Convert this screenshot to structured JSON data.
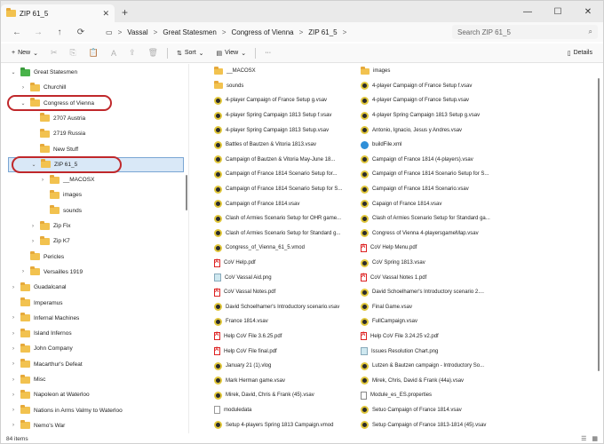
{
  "window": {
    "tab_title": "ZIP 61_5",
    "tab_close": "✕",
    "new_tab": "+",
    "minimize": "—",
    "maximize": "☐",
    "close": "✕"
  },
  "address": {
    "back": "←",
    "forward": "→",
    "up": "↑",
    "refresh": "⟳",
    "monitor_icon": "▭",
    "crumbs": [
      "Vassal",
      "Great Statesmen",
      "Congress of Vienna",
      "ZIP 61_5"
    ],
    "crumb_sep": ">",
    "search_placeholder": "Search ZIP 61_5",
    "search_icon": "⌕"
  },
  "toolbar": {
    "new_label": "New",
    "new_icon": "+",
    "sort_label": "Sort",
    "view_label": "View",
    "more_label": "···",
    "details_label": "Details",
    "cut_icon": "✂",
    "copy_icon": "⎘",
    "paste_icon": "📋",
    "rename_icon": "A",
    "share_icon": "⇪",
    "delete_icon": "🗑",
    "sort_icon": "⇅",
    "view_icon": "▤",
    "details_icon": "▯"
  },
  "nav": {
    "items": [
      {
        "label": "Great Statesmen",
        "level": 2,
        "chev": "v",
        "folder": "green"
      },
      {
        "label": "Churchill",
        "level": 3,
        "chev": ">",
        "folder": "yellow"
      },
      {
        "label": "Congress of Vienna",
        "level": 3,
        "chev": "v",
        "folder": "yellow"
      },
      {
        "label": "2707 Austria",
        "level": 4,
        "chev": "",
        "folder": "yellow"
      },
      {
        "label": "2719 Russia",
        "level": 4,
        "chev": "",
        "folder": "yellow"
      },
      {
        "label": "New Stuff",
        "level": 4,
        "chev": "",
        "folder": "yellow"
      },
      {
        "label": "ZIP 61_5",
        "level": 4,
        "chev": "v",
        "folder": "yellow"
      },
      {
        "label": "__MACOSX",
        "level": 5,
        "chev": ">",
        "folder": "yellow"
      },
      {
        "label": "images",
        "level": 5,
        "chev": "",
        "folder": "yellow"
      },
      {
        "label": "sounds",
        "level": 5,
        "chev": "",
        "folder": "yellow"
      },
      {
        "label": "Zip Fix",
        "level": 4,
        "chev": ">",
        "folder": "yellow"
      },
      {
        "label": "Zip K7",
        "level": 4,
        "chev": ">",
        "folder": "yellow"
      },
      {
        "label": "Pericles",
        "level": 3,
        "chev": "",
        "folder": "yellow"
      },
      {
        "label": "Versailles 1919",
        "level": 3,
        "chev": ">",
        "folder": "yellow"
      },
      {
        "label": "Guadalcanal",
        "level": 2,
        "chev": ">",
        "folder": "yellow"
      },
      {
        "label": "Imperamus",
        "level": 2,
        "chev": "",
        "folder": "yellow"
      },
      {
        "label": "Infernal Machines",
        "level": 2,
        "chev": ">",
        "folder": "yellow"
      },
      {
        "label": "Island Infernos",
        "level": 2,
        "chev": ">",
        "folder": "yellow"
      },
      {
        "label": "John Company",
        "level": 2,
        "chev": ">",
        "folder": "yellow"
      },
      {
        "label": "Macarthur's Defeat",
        "level": 2,
        "chev": ">",
        "folder": "yellow"
      },
      {
        "label": "Misc",
        "level": 2,
        "chev": ">",
        "folder": "yellow"
      },
      {
        "label": "Napoleon at Waterloo",
        "level": 2,
        "chev": ">",
        "folder": "yellow"
      },
      {
        "label": "Nations in Arms Valmy to Waterloo",
        "level": 2,
        "chev": ">",
        "folder": "yellow"
      },
      {
        "label": "Nemo's War",
        "level": 2,
        "chev": ">",
        "folder": "yellow"
      }
    ]
  },
  "files": {
    "col1": [
      {
        "name": "__MACOSX",
        "type": "folder"
      },
      {
        "name": "sounds",
        "type": "folder"
      },
      {
        "name": "4-player Campaign of France Setup g.vsav",
        "type": "vsav"
      },
      {
        "name": "4-player Spring Campaign 1813 Setup f.vsav",
        "type": "vsav"
      },
      {
        "name": "4-player Spring Campaign 1813 Setup.vsav",
        "type": "vsav"
      },
      {
        "name": "Battles of Bautzen & Vitoria 1813.vsav",
        "type": "vsav"
      },
      {
        "name": "Campaign of Bautzen & Vitoria  May-June 18...",
        "type": "vsav"
      },
      {
        "name": "Campaign of France 1814 Scenario Setup for...",
        "type": "vsav"
      },
      {
        "name": "Campaign of France 1814 Scenario Setup for S...",
        "type": "vsav"
      },
      {
        "name": "Campaign of France 1814.vsav",
        "type": "vsav"
      },
      {
        "name": "Clash of Armies Scenario Setup for OHR game...",
        "type": "vsav"
      },
      {
        "name": "Clash of Armies Scenario Setup for Standard g...",
        "type": "vsav"
      },
      {
        "name": "Congress_of_Vienna_61_5.vmod",
        "type": "vmod"
      },
      {
        "name": "CoV Help.pdf",
        "type": "pdf"
      },
      {
        "name": "CoV Vassal Aid.png",
        "type": "png"
      },
      {
        "name": "CoV Vassal Notes.pdf",
        "type": "pdf"
      },
      {
        "name": "David Schoelhamer's Introductory scenario.vsav",
        "type": "vsav"
      },
      {
        "name": "France 1814.vsav",
        "type": "vsav"
      },
      {
        "name": "Help CoV File 3.6.25.pdf",
        "type": "pdf"
      },
      {
        "name": "Help CoV File final.pdf",
        "type": "pdf"
      },
      {
        "name": "January 21 (1).vlog",
        "type": "vlog"
      },
      {
        "name": "Mark Herman game.vsav",
        "type": "vsav"
      },
      {
        "name": "Mirek, David, Chris & Frank (45).vsav",
        "type": "vsav"
      },
      {
        "name": "moduledata",
        "type": "blank"
      },
      {
        "name": "Setup 4-players Spring 1813 Campaign.vmod",
        "type": "vmod"
      }
    ],
    "col2": [
      {
        "name": "images",
        "type": "folder"
      },
      {
        "name": "4-player Campaign of France Setup f.vsav",
        "type": "vsav"
      },
      {
        "name": "4-player Campaign of France Setup.vsav",
        "type": "vsav"
      },
      {
        "name": "4-player Spring Campaign 1813 Setup g.vsav",
        "type": "vsav"
      },
      {
        "name": "Antonio, Ignacio, Jesus y Andres.vsav",
        "type": "vsav"
      },
      {
        "name": "buildFile.xml",
        "type": "xml"
      },
      {
        "name": "Campaign of France 1814 (4-players).vsav",
        "type": "vsav"
      },
      {
        "name": "Campaign of France 1814 Scenario Setup for S...",
        "type": "vsav"
      },
      {
        "name": "Campaign of France 1814 Scenario.vsav",
        "type": "vsav"
      },
      {
        "name": "Capaign of France 1814.vsav",
        "type": "vsav"
      },
      {
        "name": "Clash of Armies Scenario Setup for Standard ga...",
        "type": "vsav"
      },
      {
        "name": "Congress of Vienna 4-playersgameMap.vsav",
        "type": "vsav"
      },
      {
        "name": "CoV Help Menu.pdf",
        "type": "pdf"
      },
      {
        "name": "CoV Spring 1813.vsav",
        "type": "vsav"
      },
      {
        "name": "CoV Vassal Notes 1.pdf",
        "type": "pdf"
      },
      {
        "name": "David Schoelhamer's Introductory scenario 2....",
        "type": "vsav"
      },
      {
        "name": "Final Game.vsav",
        "type": "vsav"
      },
      {
        "name": "FullCampaign.vsav",
        "type": "vsav"
      },
      {
        "name": "Help CoV File 3.24.25 v2.pdf",
        "type": "pdf"
      },
      {
        "name": "Issues Resolution Chart.png",
        "type": "png"
      },
      {
        "name": "Lutzen & Bautzen campaign - Introductory So...",
        "type": "vsav"
      },
      {
        "name": "Mirek, Chris, David & Frank (44a).vsav",
        "type": "vsav"
      },
      {
        "name": "Module_es_ES.properties",
        "type": "props"
      },
      {
        "name": "Setuo Campaign of France 1814.vsav",
        "type": "vsav"
      },
      {
        "name": "Setup Campaign of France 1813-1814 (45).vsav",
        "type": "vsav"
      }
    ]
  },
  "status": {
    "count": "84 items",
    "list_icon": "☰",
    "grid_icon": "▦"
  }
}
